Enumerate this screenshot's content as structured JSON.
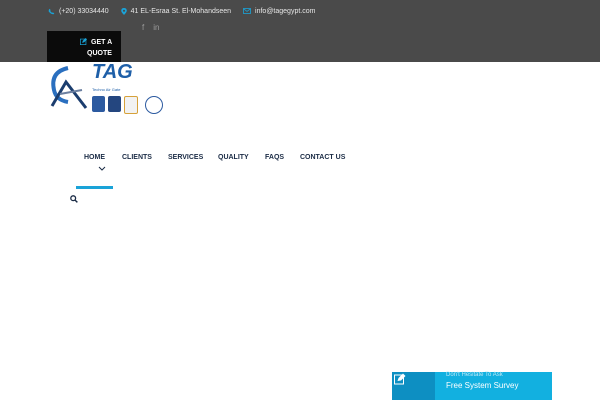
{
  "topbar": {
    "phone": "(+20) 33034440",
    "address": "41 EL-Esraa St. El-Mohandseen",
    "email": "info@tagegypt.com",
    "social": [
      {
        "label": "f",
        "icon": "facebook-icon"
      },
      {
        "label": "in",
        "icon": "linkedin-icon"
      }
    ],
    "quote_line1": "GET A",
    "quote_line2": "QUOTE"
  },
  "logo": {
    "name": "TAG",
    "tagline": "Techno Air Gate"
  },
  "nav": {
    "items": [
      {
        "label": "HOME",
        "active": true
      },
      {
        "label": "CLIENTS"
      },
      {
        "label": "SERVICES",
        "has_dropdown": true
      },
      {
        "label": "QUALITY"
      },
      {
        "label": "FAQS"
      },
      {
        "label": "CONTACT US"
      }
    ]
  },
  "survey": {
    "small": "Don't Hesitate To Ask",
    "title": "Free System Survey"
  },
  "colors": {
    "topbar": "#4a4a4a",
    "accent": "#1aa3d8",
    "quote_bg": "#0b0b0b",
    "nav_text": "#1a2b45",
    "survey_bg": "#12b0e0"
  }
}
